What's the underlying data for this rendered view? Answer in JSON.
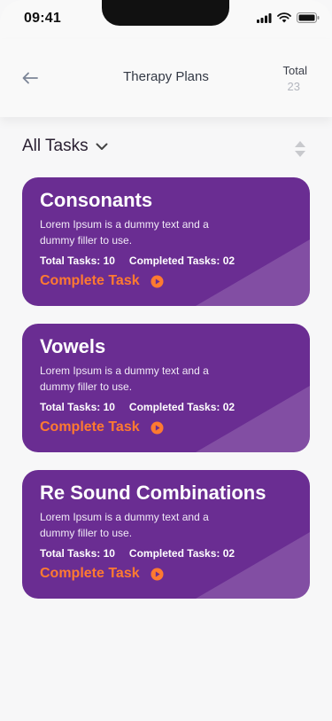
{
  "status_bar": {
    "time": "09:41"
  },
  "header": {
    "title": "Therapy Plans",
    "total_label": "Total",
    "total_value": "23"
  },
  "filter": {
    "label": "All Tasks"
  },
  "cards": [
    {
      "title": "Consonants",
      "description": "Lorem Ipsum is a dummy text and a dummy filler to use.",
      "total_tasks": "Total Tasks: 10",
      "completed_tasks": "Completed Tasks: 02",
      "action_label": "Complete Task"
    },
    {
      "title": "Vowels",
      "description": "Lorem Ipsum is a dummy text and a dummy filler to use.",
      "total_tasks": "Total Tasks: 10",
      "completed_tasks": "Completed Tasks: 02",
      "action_label": "Complete Task"
    },
    {
      "title": "Re Sound Combinations",
      "description": "Lorem Ipsum is a dummy text and a dummy filler to use.",
      "total_tasks": "Total Tasks: 10",
      "completed_tasks": "Completed Tasks: 02",
      "action_label": "Complete Task"
    }
  ],
  "colors": {
    "card_background": "#6a2d92",
    "action_orange": "#ff7a30",
    "page_background": "#f7f7f8"
  },
  "icons": {
    "back": "arrow-left-icon",
    "dropdown": "chevron-down-icon",
    "sort": "sort-icon",
    "play": "play-circle-icon",
    "signal": "signal-icon",
    "wifi": "wifi-icon",
    "battery": "battery-icon"
  }
}
